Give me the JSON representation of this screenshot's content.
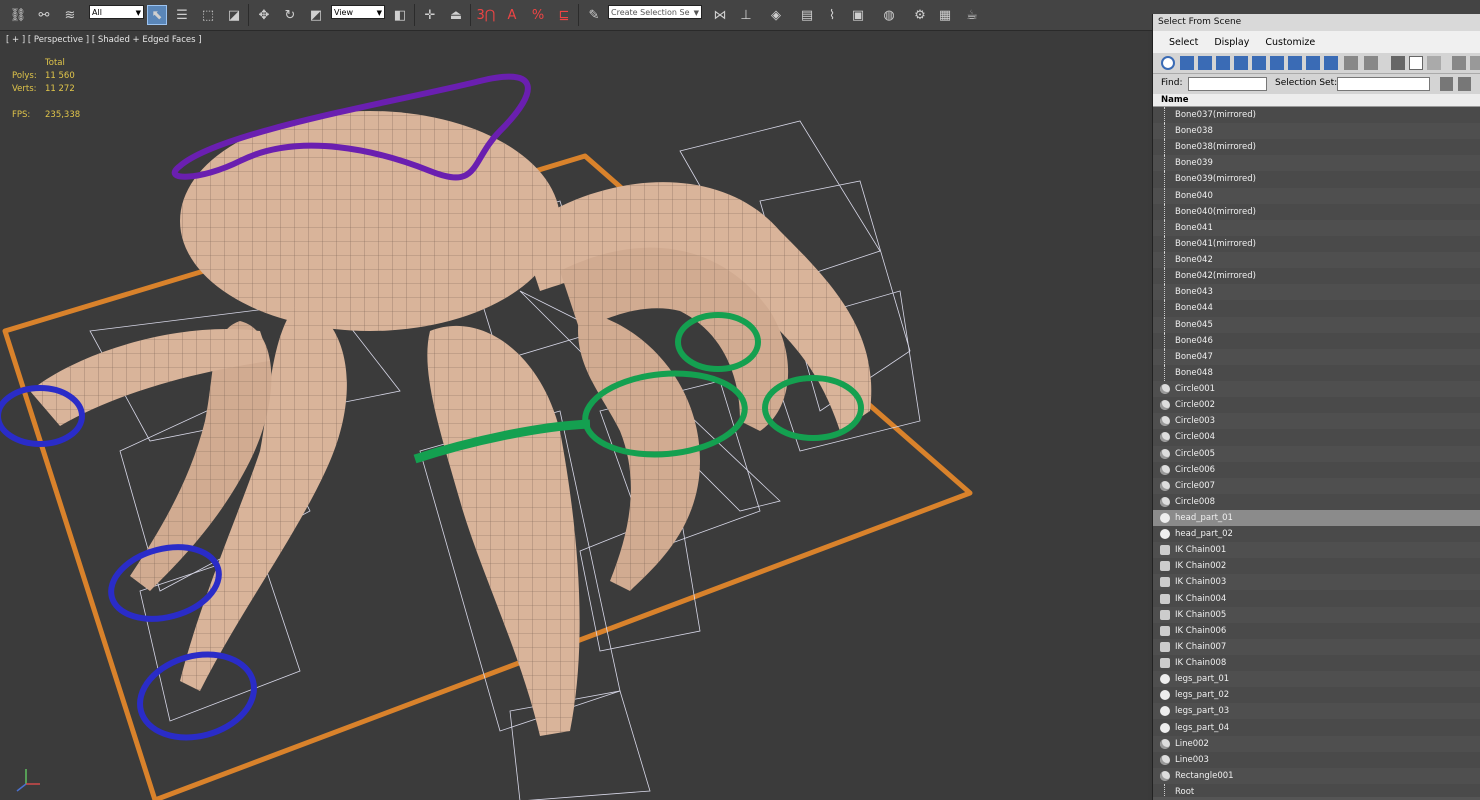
{
  "toolbar": {
    "filter_value": "All",
    "view_value": "View",
    "selection_set_placeholder": "Create Selection Se",
    "snap_3": "3",
    "snap_angle": "A",
    "snap_percent": "%"
  },
  "viewport": {
    "label": "[ + ] [ Perspective ] [ Shaded + Edged Faces ]",
    "stats": {
      "header": "Total",
      "polys_label": "Polys:",
      "polys_value": "11 560",
      "verts_label": "Verts:",
      "verts_value": "11 272",
      "fps_label": "FPS:",
      "fps_value": "235,338"
    },
    "colors": {
      "halo": "#6a1fb0",
      "rings_blue": "#2a2cc8",
      "rings_green": "#14a050",
      "plane": "#d9822b",
      "body": "#d9b49a"
    }
  },
  "panel": {
    "title": "Select From Scene",
    "menu": [
      "Select",
      "Display",
      "Customize"
    ],
    "find_label": "Find:",
    "selection_set_label": "Selection Set:",
    "column_name": "Name",
    "items": [
      {
        "name": "Bone037(mirrored)",
        "icon": "bone-icon"
      },
      {
        "name": "Bone038",
        "icon": "bone-icon"
      },
      {
        "name": "Bone038(mirrored)",
        "icon": "bone-icon"
      },
      {
        "name": "Bone039",
        "icon": "bone-icon"
      },
      {
        "name": "Bone039(mirrored)",
        "icon": "bone-icon"
      },
      {
        "name": "Bone040",
        "icon": "bone-icon"
      },
      {
        "name": "Bone040(mirrored)",
        "icon": "bone-icon"
      },
      {
        "name": "Bone041",
        "icon": "bone-icon"
      },
      {
        "name": "Bone041(mirrored)",
        "icon": "bone-icon"
      },
      {
        "name": "Bone042",
        "icon": "bone-icon"
      },
      {
        "name": "Bone042(mirrored)",
        "icon": "bone-icon"
      },
      {
        "name": "Bone043",
        "icon": "bone-icon"
      },
      {
        "name": "Bone044",
        "icon": "bone-icon"
      },
      {
        "name": "Bone045",
        "icon": "bone-icon"
      },
      {
        "name": "Bone046",
        "icon": "bone-icon"
      },
      {
        "name": "Bone047",
        "icon": "bone-icon"
      },
      {
        "name": "Bone048",
        "icon": "bone-icon"
      },
      {
        "name": "Circle001",
        "icon": "shape-icon"
      },
      {
        "name": "Circle002",
        "icon": "shape-icon"
      },
      {
        "name": "Circle003",
        "icon": "shape-icon"
      },
      {
        "name": "Circle004",
        "icon": "shape-icon"
      },
      {
        "name": "Circle005",
        "icon": "shape-icon"
      },
      {
        "name": "Circle006",
        "icon": "shape-icon"
      },
      {
        "name": "Circle007",
        "icon": "shape-icon"
      },
      {
        "name": "Circle008",
        "icon": "shape-icon"
      },
      {
        "name": "head_part_01",
        "icon": "geometry-icon",
        "selected": true
      },
      {
        "name": "head_part_02",
        "icon": "geometry-icon"
      },
      {
        "name": "IK Chain001",
        "icon": "ik-chain-icon"
      },
      {
        "name": "IK Chain002",
        "icon": "ik-chain-icon"
      },
      {
        "name": "IK Chain003",
        "icon": "ik-chain-icon"
      },
      {
        "name": "IK Chain004",
        "icon": "ik-chain-icon"
      },
      {
        "name": "IK Chain005",
        "icon": "ik-chain-icon"
      },
      {
        "name": "IK Chain006",
        "icon": "ik-chain-icon"
      },
      {
        "name": "IK Chain007",
        "icon": "ik-chain-icon"
      },
      {
        "name": "IK Chain008",
        "icon": "ik-chain-icon"
      },
      {
        "name": "legs_part_01",
        "icon": "geometry-icon"
      },
      {
        "name": "legs_part_02",
        "icon": "geometry-icon"
      },
      {
        "name": "legs_part_03",
        "icon": "geometry-icon"
      },
      {
        "name": "legs_part_04",
        "icon": "geometry-icon"
      },
      {
        "name": "Line002",
        "icon": "shape-icon"
      },
      {
        "name": "Line003",
        "icon": "shape-icon"
      },
      {
        "name": "Rectangle001",
        "icon": "shape-icon"
      },
      {
        "name": "Root",
        "icon": "bone-icon"
      }
    ]
  }
}
